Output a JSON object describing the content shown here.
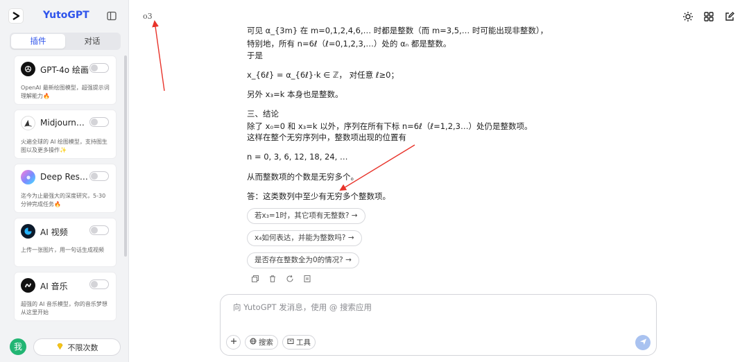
{
  "sidebar": {
    "brand": "YutoGPT",
    "tabs": [
      "插件",
      "对话"
    ],
    "plugins": [
      {
        "name": "GPT-4o 绘画",
        "desc": "OpenAI 最新绘图模型，超强提示词理解能力🔥"
      },
      {
        "name": "Midjourne...",
        "desc": "火遍全球的 AI 绘图模型，支持图生图以及更多操作✨"
      },
      {
        "name": "Deep Rese...",
        "desc": "迄今为止最强大的深度研究，5-30 分钟完成任务🔥"
      },
      {
        "name": "AI 视频",
        "desc": "上传一张图片，用一句话生成视频"
      },
      {
        "name": "AI 音乐",
        "desc": "超强的 AI 音乐模型，你的音乐梦想从这里开始"
      }
    ],
    "avatar": "我",
    "quota": "不限次数"
  },
  "main": {
    "model": "o3",
    "lines": [
      "可见 α_{3m} 在 m=0,1,2,4,6,… 时都是整数（而 m=3,5,… 时可能出现非整数），",
      "特别地，所有 n=6ℓ（ℓ=0,1,2,3,…）处的 αₙ 都是整数。",
      "于是",
      "x_{6ℓ} = α_{6ℓ}·k ∈ ℤ，  对任意 ℓ≥0；",
      "另外 x₃=k 本身也是整数。",
      "三、结论",
      "除了 x₀=0 和 x₃=k 以外，序列在所有下标 n=6ℓ（ℓ=1,2,3…）处仍是整数项。",
      "这样在整个无穷序列中，整数项出现的位置有",
      "n = 0, 3, 6, 12, 18, 24, …",
      "从而整数项的个数是无穷多个。",
      "答：这类数列中至少有无穷多个整数项。"
    ],
    "suggestions": [
      "若x₃=1时，其它项有无整数?  →",
      "x₄如何表达，并能为整数吗?  →",
      "是否存在整数全为0的情况?  →"
    ],
    "composer": {
      "placeholder": "向 YutoGPT 发消息，使用 @ 搜索应用",
      "search": "搜索",
      "tools": "工具"
    }
  }
}
